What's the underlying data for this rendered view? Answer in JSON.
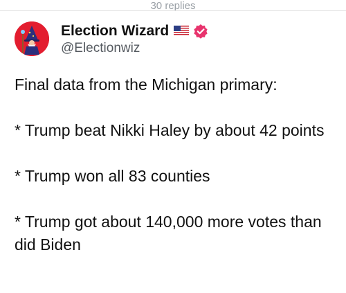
{
  "thread": {
    "replies_label": "30 replies"
  },
  "author": {
    "display_name": "Election Wizard",
    "handle": "@Electionwiz",
    "flag_icon": "us-flag-icon",
    "verified_icon": "verified-badge-icon",
    "verified_color": "#e8336d",
    "avatar_color": "#e31d2f"
  },
  "post": {
    "lines": [
      "Final data from the Michigan primary:",
      "* Trump beat Nikki Haley by about 42 points",
      "* Trump won all 83 counties",
      "* Trump got about 140,000 more votes than did Biden"
    ]
  }
}
